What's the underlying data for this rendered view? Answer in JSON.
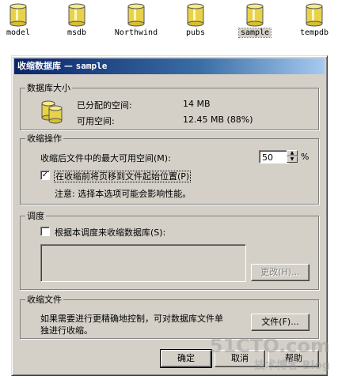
{
  "databases": [
    {
      "name": "model",
      "selected": false
    },
    {
      "name": "msdb",
      "selected": false
    },
    {
      "name": "Northwind",
      "selected": false
    },
    {
      "name": "pubs",
      "selected": false
    },
    {
      "name": "sample",
      "selected": true
    },
    {
      "name": "tempdb",
      "selected": false
    }
  ],
  "dialog": {
    "title_prefix": "收缩数据库 — ",
    "title_db": "sample",
    "size_group": {
      "legend": "数据库大小",
      "allocated_label": "已分配的空间:",
      "allocated_value": "14 MB",
      "free_label": "可用空间:",
      "free_value": "12.45 MB (88%)"
    },
    "shrink_group": {
      "legend": "收缩操作",
      "max_free_label": "收缩后文件中的最大可用空间(M):",
      "max_free_value": "50",
      "percent_sign": "%",
      "move_pages_label": "在收缩前将页移到文件起始位置(P)",
      "move_pages_checked": true,
      "note": "注意: 选择本选项可能会影响性能。"
    },
    "schedule_group": {
      "legend": "调度",
      "schedule_label": "根据本调度来收缩数据库(S):",
      "schedule_checked": false,
      "change_button": "更改(H)..."
    },
    "files_group": {
      "legend": "收缩文件",
      "description_line1": "如果需要进行更精确地控制，可对数据库文件单",
      "description_line2": "独进行收缩。",
      "files_button": "文件(F)..."
    },
    "buttons": {
      "ok": "确定",
      "cancel": "取消",
      "help": "帮助"
    }
  },
  "watermark": {
    "line1": "51CTO.com",
    "line2": "技术博客   Blog"
  },
  "colors": {
    "dialog_face": "#d4d0c8",
    "title_start": "#0a246a",
    "title_end": "#a6caf0",
    "db_icon": "#e8d24a"
  }
}
